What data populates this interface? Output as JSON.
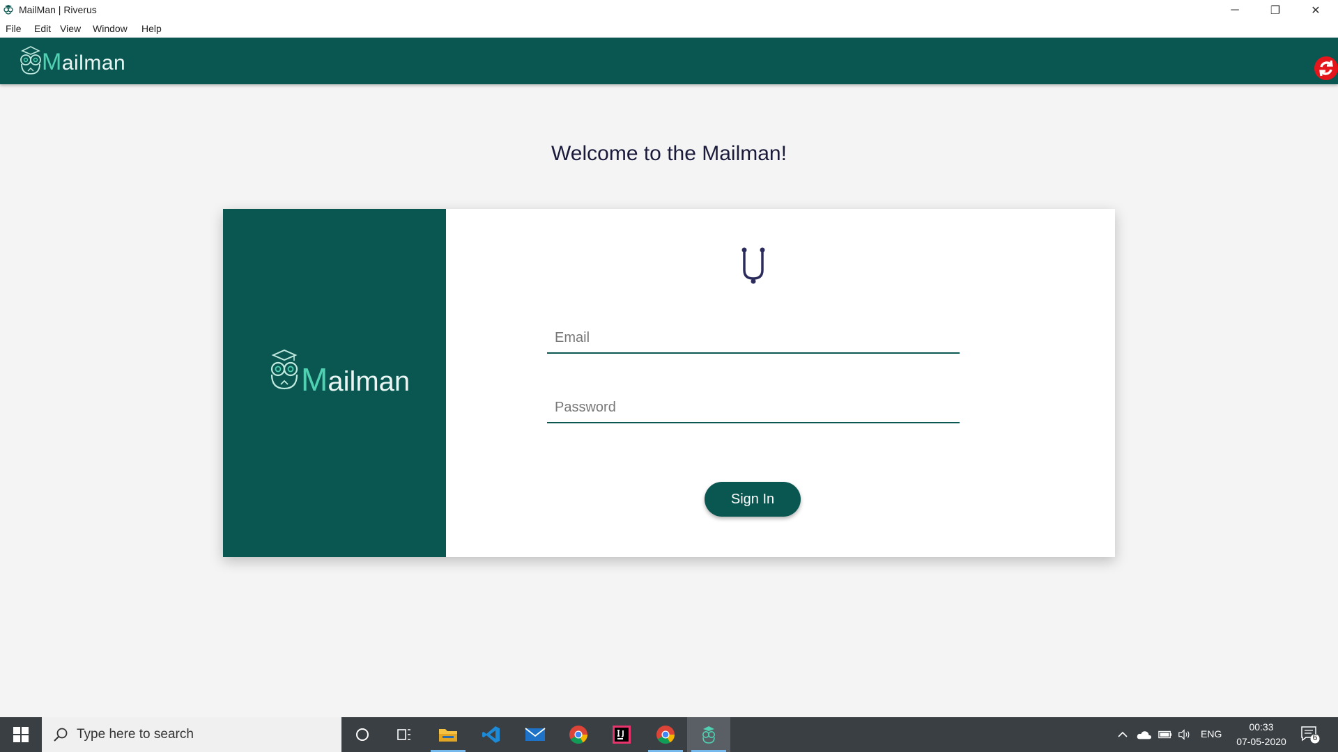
{
  "window": {
    "title": "MailMan | Riverus",
    "controls": {
      "minimize": "─",
      "restore": "❐",
      "close": "✕"
    }
  },
  "menu": [
    "File",
    "Edit",
    "View",
    "Window",
    "Help"
  ],
  "appbar": {
    "logo_initial": "M",
    "logo_rest": "ailman"
  },
  "login": {
    "welcome": "Welcome to the Mailman!",
    "brand_initial": "M",
    "brand_rest": "ailman",
    "email_placeholder": "Email",
    "email_value": "",
    "password_placeholder": "Password",
    "password_value": "",
    "signin_label": "Sign In"
  },
  "taskbar": {
    "search_placeholder": "Type here to search",
    "apps": [
      "cortana-icon",
      "task-view-icon",
      "file-explorer-icon",
      "vscode-icon",
      "mail-icon",
      "chrome-icon",
      "intellij-icon",
      "chrome-icon",
      "mailman-icon"
    ],
    "language": "ENG",
    "time": "00:33",
    "date": "07-05-2020",
    "notification_count": "6"
  },
  "colors": {
    "brand": "#0a5751",
    "accent": "#4fd1b2",
    "sync": "#e4161c",
    "taskbar": "#3a3f44"
  }
}
